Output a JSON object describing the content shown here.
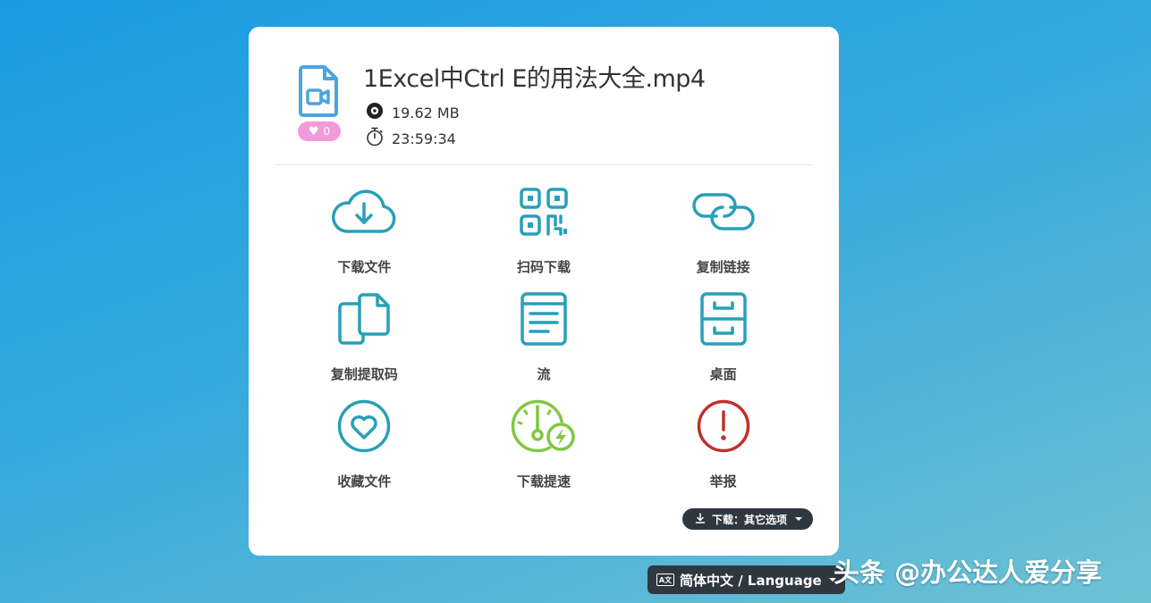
{
  "file": {
    "name": "1Excel中Ctrl E的用法大全.mp4",
    "size": "19.62 MB",
    "duration": "23:59:34",
    "likes": "0",
    "icon": "video-file-icon"
  },
  "actions": [
    {
      "label": "下载文件",
      "icon": "cloud-download-icon"
    },
    {
      "label": "扫码下载",
      "icon": "qr-code-icon"
    },
    {
      "label": "复制链接",
      "icon": "link-icon"
    },
    {
      "label": "复制提取码",
      "icon": "copy-icon"
    },
    {
      "label": "流",
      "icon": "document-lines-icon"
    },
    {
      "label": "桌面",
      "icon": "cabinet-icon"
    },
    {
      "label": "收藏文件",
      "icon": "heart-circle-icon"
    },
    {
      "label": "下载提速",
      "icon": "speed-boost-icon"
    },
    {
      "label": "举报",
      "icon": "report-exclamation-icon"
    }
  ],
  "download_other": "下载：其它选项",
  "language": {
    "label": "简体中文 / Language"
  },
  "watermark": "头条 @办公达人爱分享",
  "colors": {
    "teal": "#27a0b8",
    "green": "#7fc843",
    "red": "#c0302b",
    "pink": "#f49ad9",
    "dark": "#2f3740",
    "file_blue": "#4aa4e0"
  }
}
